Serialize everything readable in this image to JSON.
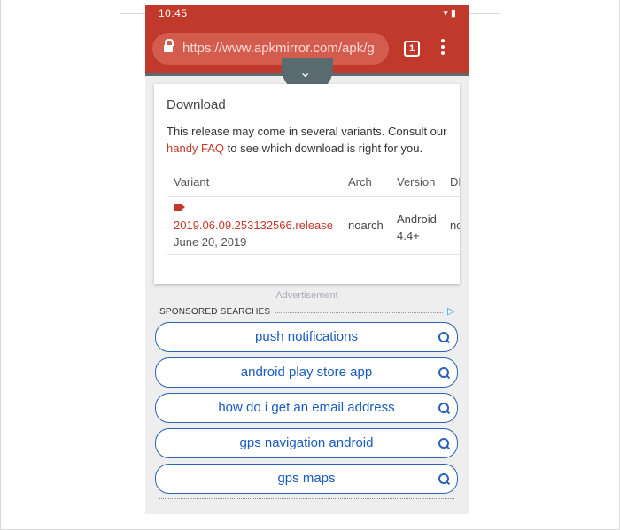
{
  "status": {
    "time": "10:45",
    "icons": "▾ ▮"
  },
  "browser": {
    "url": "https://www.apkmirror.com/apk/g",
    "tab_count": "1"
  },
  "download": {
    "title": "Download",
    "intro_text": "This release may come in several variants. Consult our ",
    "faq_link": "handy FAQ",
    "intro_tail": " to see which download is right for you.",
    "columns": [
      "Variant",
      "Arch",
      "Version",
      "DPI"
    ],
    "row": {
      "release": "2019.06.09.253132566.release",
      "date": "June 20, 2019",
      "arch": "noarch",
      "version_line1": "Android",
      "version_line2": "4.4+",
      "dpi": "nodpi"
    }
  },
  "ads": {
    "label": "Advertisement",
    "sponsored_label": "SPONSORED SEARCHES",
    "searches": [
      "push notifications",
      "android play store app",
      "how do i get an email address",
      "gps navigation android",
      "gps maps"
    ]
  }
}
